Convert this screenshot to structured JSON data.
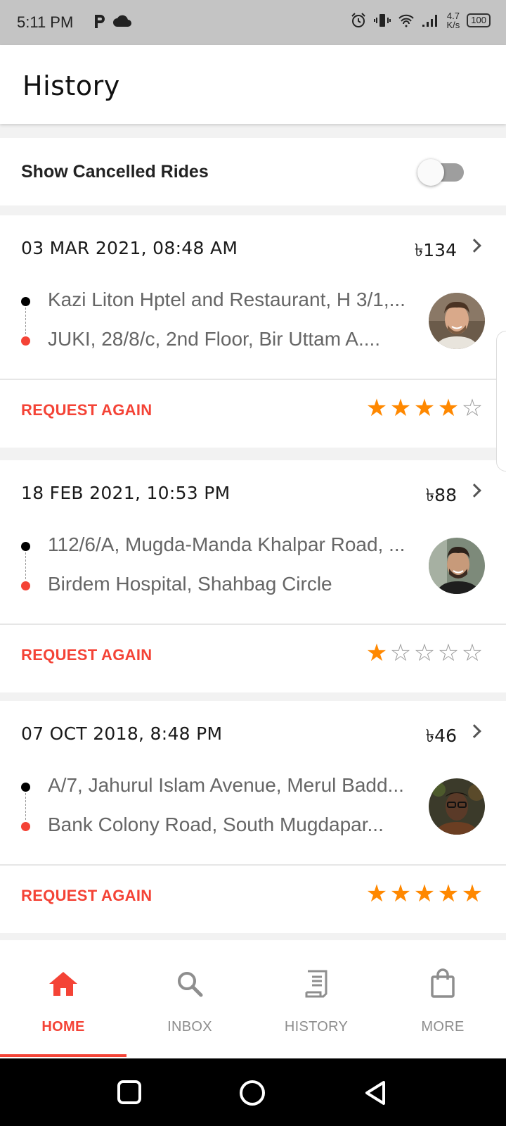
{
  "status_bar": {
    "time": "5:11 PM",
    "speed_value": "4.7",
    "speed_unit": "K/s",
    "battery": "100"
  },
  "app_bar": {
    "title": "History"
  },
  "filter": {
    "label": "Show Cancelled Rides",
    "enabled": false
  },
  "rides": [
    {
      "date": "03 MAR 2021, 08:48 AM",
      "fare": "৳134",
      "pickup": "Kazi Liton Hptel and Restaurant, H 3/1,...",
      "dropoff": "JUKI, 28/8/c, 2nd Floor, Bir Uttam A....",
      "action": "REQUEST AGAIN",
      "rating": 4
    },
    {
      "date": "18 FEB 2021, 10:53 PM",
      "fare": "৳88",
      "pickup": "112/6/A, Mugda-Manda Khalpar Road, ...",
      "dropoff": "Birdem Hospital, Shahbag Circle",
      "action": "REQUEST AGAIN",
      "rating": 1
    },
    {
      "date": "07 OCT 2018, 8:48 PM",
      "fare": "৳46",
      "pickup": "A/7, Jahurul Islam Avenue, Merul Badd...",
      "dropoff": "Bank Colony Road, South Mugdapar...",
      "action": "REQUEST AGAIN",
      "rating": 5
    }
  ],
  "bottom_nav": [
    {
      "label": "HOME",
      "icon": "home-icon",
      "active": true
    },
    {
      "label": "INBOX",
      "icon": "search-icon",
      "active": false
    },
    {
      "label": "HISTORY",
      "icon": "receipt-icon",
      "active": false
    },
    {
      "label": "MORE",
      "icon": "bag-icon",
      "active": false
    }
  ],
  "colors": {
    "accent": "#f44336",
    "star": "#ff8800",
    "status_bar": "#c4c4c4"
  }
}
